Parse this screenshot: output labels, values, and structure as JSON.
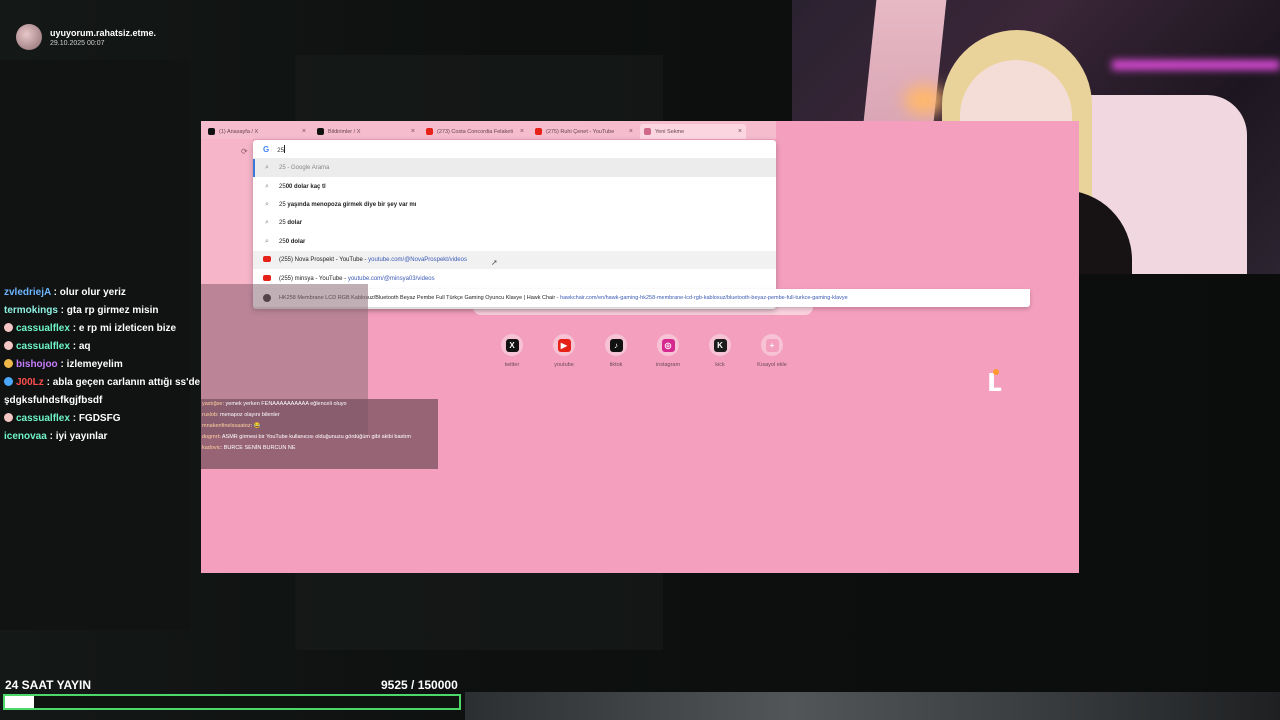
{
  "notification": {
    "username": "uyuyorum.rahatsiz.etme.",
    "time": "29.10.2025 00:07"
  },
  "chat": [
    {
      "user": "zvledriejA",
      "user_color": "#6db5ff",
      "msg": "olur olur yeriz",
      "badge": ""
    },
    {
      "user": "termokings",
      "user_color": "#8ef0e0",
      "msg": "gta rp girmez misin",
      "badge": ""
    },
    {
      "user": "cassualflex",
      "user_color": "#6ff5c9",
      "msg": "e rp mi izleticen bize",
      "badge": "#f5c6c6"
    },
    {
      "user": "cassualflex",
      "user_color": "#6ff5c9",
      "msg": "aq",
      "badge": "#f5c6c6"
    },
    {
      "user": "bishojoo",
      "user_color": "#c77dff",
      "msg": "izlemeyelim",
      "badge": "#f0b84a"
    },
    {
      "user": "J00Lz",
      "user_color": "#ff4d4d",
      "msg": "abla geçen carlanın attığı ss'de sen ne yapıyodun şdgksfuhdsfkgjfbsdf",
      "badge": "#4aa8ff"
    },
    {
      "user": "cassualflex",
      "user_color": "#6ff5c9",
      "msg": "FGDSFG",
      "badge": "#f5c6c6"
    },
    {
      "user": "icenovaa",
      "user_color": "#6ff5c9",
      "msg": "iyi yayınlar",
      "badge": ""
    }
  ],
  "browser": {
    "tabs": [
      {
        "label": "(1) Anasayfa / X",
        "icon_color": "#111111",
        "active": false
      },
      {
        "label": "Bildirimler / X",
        "icon_color": "#111111",
        "active": false
      },
      {
        "label": "(273) Costa Concordia Felaketi",
        "icon_color": "#e62117",
        "active": false
      },
      {
        "label": "(275) Ruhi Çenet - YouTube",
        "icon_color": "#e62117",
        "active": false
      },
      {
        "label": "Yeni Sekme",
        "icon_color": "#d0688a",
        "active": true
      }
    ],
    "omnibox_value": "25",
    "suggestions": [
      {
        "type": "search",
        "bold": "",
        "text": "25 - Google Arama",
        "url": "",
        "style": "hl"
      },
      {
        "type": "search",
        "bold": "00 dolar kaç tl",
        "text": "25",
        "url": "",
        "style": ""
      },
      {
        "type": "search",
        "bold": " yaşında menopoza girmek diye bir şey var mı",
        "text": "25",
        "url": "",
        "style": ""
      },
      {
        "type": "search",
        "bold": " dolar",
        "text": "25",
        "url": "",
        "style": ""
      },
      {
        "type": "search",
        "bold": "0 dolar",
        "text": "25",
        "url": "",
        "style": ""
      },
      {
        "type": "youtube",
        "bold": "",
        "text": "(255) Nova Prospekt - YouTube - ",
        "url": "youtube.com/@NovaProspekt/videos",
        "style": "hover"
      },
      {
        "type": "youtube",
        "bold": "",
        "text": "(255) minsya - YouTube - ",
        "url": "youtube.com/@minsya03/videos",
        "style": ""
      }
    ],
    "wide_suggestion": {
      "text": "HK258 Membrane LCD RGB Kablosuz/Bluetooth Beyaz Pembe Full Türkçe Gaming Oyuncu Klavye | Hawk Chair - ",
      "url": "hawkchair.com/en/hawk-gaming-hk258-membrane-lcd-rgb-kablosuz/bluetooth-beyaz-pembe-full-turkce-gaming-klavye"
    },
    "shortcuts": [
      {
        "label": "twitter",
        "glyph": "X",
        "color": "#111111"
      },
      {
        "label": "youtube",
        "glyph": "▶",
        "color": "#e62117"
      },
      {
        "label": "tiktok",
        "glyph": "♪",
        "color": "#111111"
      },
      {
        "label": "instagram",
        "glyph": "◎",
        "color": "#d6298f"
      },
      {
        "label": "kick",
        "glyph": "K",
        "color": "#1c1c1c"
      },
      {
        "label": "Kısayol ekle",
        "glyph": "+",
        "color": "#f39fbd"
      }
    ]
  },
  "mini_chat": [
    {
      "name": "yastığse",
      "msg": "yemek yerken FENAAAAAAAAAA eğlenceli oluyo"
    },
    {
      "name": "ruslob",
      "msg": "menapoz olayını bilenler"
    },
    {
      "name": "mnakenfinelssaatoz",
      "msg": "😂"
    },
    {
      "name": "dogmrt",
      "msg": "ASMR girmesi bir YouTube kullanıcısı olduğunuzu gördüğüm gibi akibi bastım"
    },
    {
      "name": "kadovic",
      "msg": "BURCE SENİN BURCUN NE"
    }
  ],
  "stream": {
    "title": "24 SAAT YAYIN",
    "count_text": "9525  / 150000",
    "progress_fraction": 0.0635
  },
  "colors": {
    "progress_border": "#4fd86a",
    "browser_bg": "#f39fbd"
  }
}
